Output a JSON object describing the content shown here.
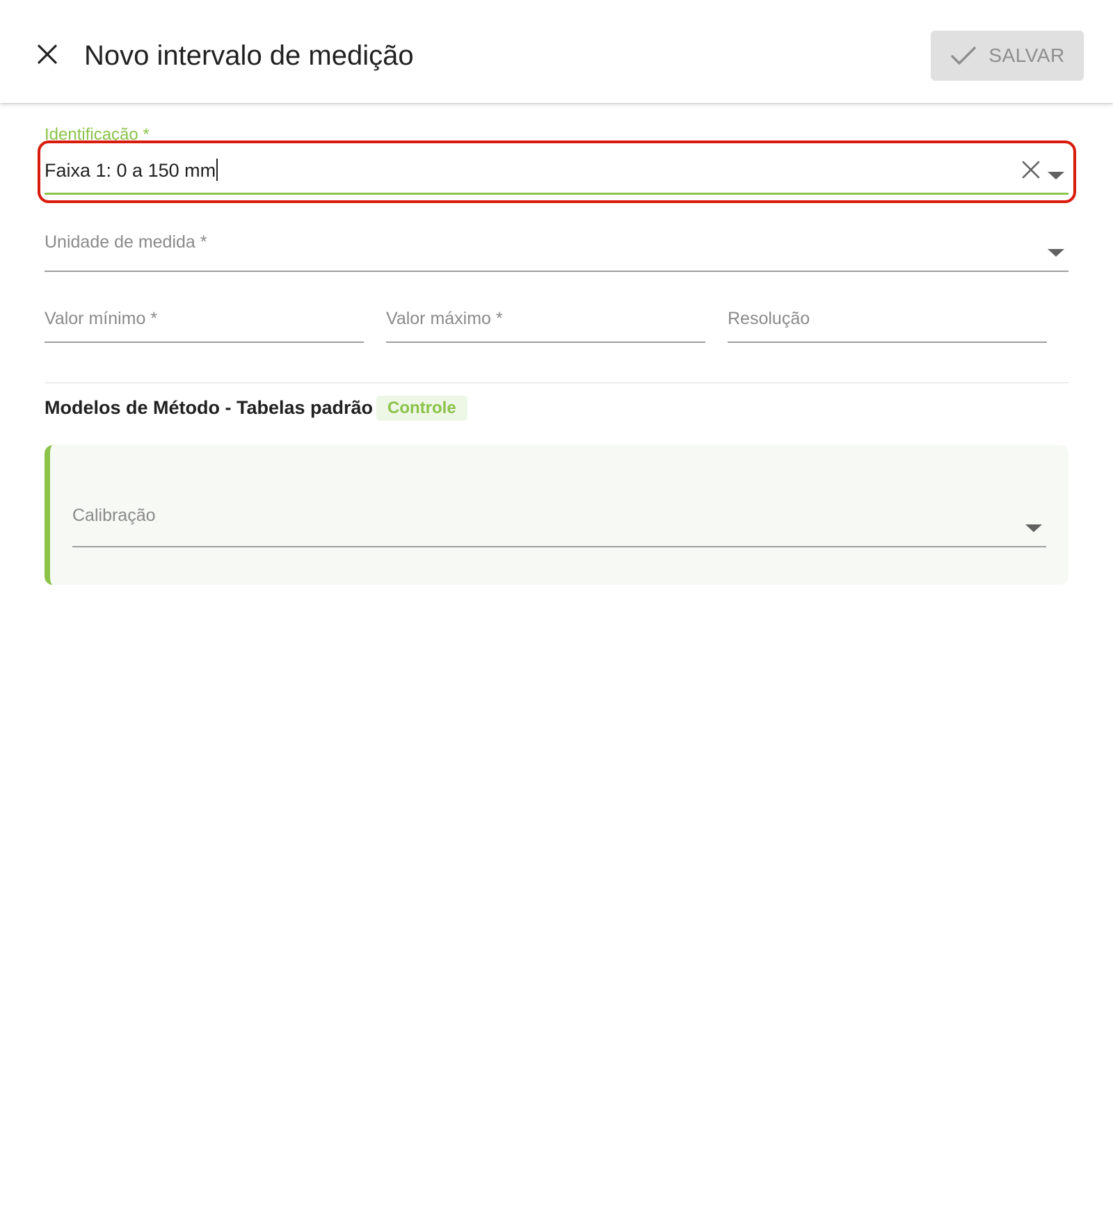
{
  "header": {
    "title": "Novo intervalo de medição",
    "save_label": "SALVAR",
    "icons": {
      "close": "close-icon",
      "save": "check-icon"
    }
  },
  "form": {
    "identificacao": {
      "label": "Identificação *",
      "value": "Faixa 1: 0 a 150 mm"
    },
    "unidade": {
      "label": "Unidade de medida *"
    },
    "valor_minimo": {
      "label": "Valor mínimo *"
    },
    "valor_maximo": {
      "label": "Valor máximo *"
    },
    "resolucao": {
      "label": "Resolução"
    }
  },
  "section": {
    "title": "Modelos de Método - Tabelas padrão",
    "badge": "Controle",
    "calibracao": {
      "label": "Calibração"
    }
  },
  "colors": {
    "accent": "#8bc34a",
    "highlight": "#d81b0c",
    "disabled_button": "#e0e0e0"
  }
}
